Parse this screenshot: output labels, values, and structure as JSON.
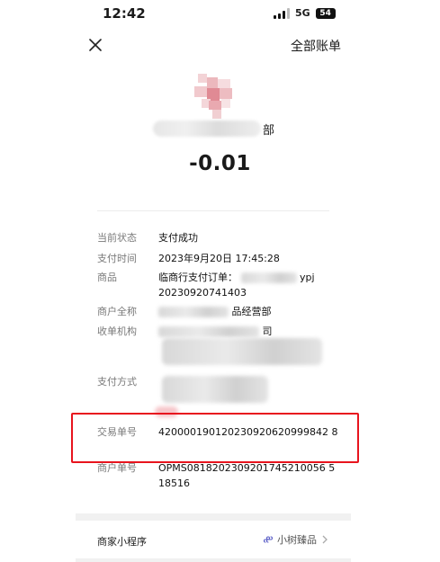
{
  "status_bar": {
    "time": "12:42",
    "network": "5G",
    "battery": "54"
  },
  "nav": {
    "right_label": "全部账单"
  },
  "merchant": {
    "name_suffix": "部"
  },
  "amount": "-0.01",
  "details": {
    "status": {
      "label": "当前状态",
      "value": "支付成功"
    },
    "pay_time": {
      "label": "支付时间",
      "value": "2023年9月20日 17:45:28"
    },
    "product": {
      "label": "商品",
      "value_prefix": "临商行支付订单：",
      "value_mid": "ypj",
      "value_line2": "20230920741403"
    },
    "merchant_full": {
      "label": "商户全称",
      "value": "品经营部"
    },
    "acquirer": {
      "label": "收单机构",
      "value": "司"
    },
    "pay_method": {
      "label": "支付方式"
    },
    "transaction_no": {
      "label": "交易单号",
      "value": "420000190120230920620999842 8"
    },
    "merchant_order": {
      "label": "商户单号",
      "value": "OPMS0818202309201745210056 518516"
    }
  },
  "mini_program": {
    "label": "商家小程序",
    "value": "小树臻品"
  },
  "colors": {
    "highlight": "#e8141e",
    "avatar": "#e8a0a8"
  }
}
